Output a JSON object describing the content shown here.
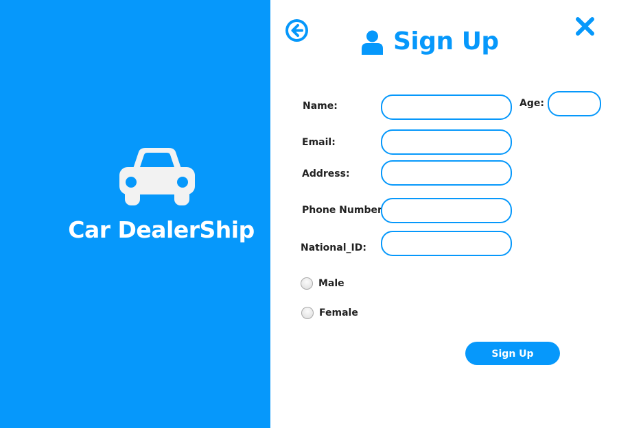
{
  "brand": {
    "title": "Car DealerShip",
    "icon": "car-icon"
  },
  "header": {
    "title": "Sign Up",
    "back_icon": "arrow-left-circle-icon",
    "close_icon": "close-x-icon",
    "user_icon": "user-icon"
  },
  "form": {
    "name": {
      "label": "Name:",
      "value": ""
    },
    "age": {
      "label": "Age:",
      "value": ""
    },
    "email": {
      "label": "Email:",
      "value": ""
    },
    "address": {
      "label": "Address:",
      "value": ""
    },
    "phone": {
      "label": "Phone Number:",
      "value": ""
    },
    "national_id": {
      "label": "National_ID:",
      "value": ""
    },
    "gender_options": [
      {
        "label": "Male",
        "selected": false
      },
      {
        "label": "Female",
        "selected": false
      }
    ],
    "submit_label": "Sign Up"
  },
  "colors": {
    "accent": "#0698fb",
    "panel_text": "#ffffff",
    "label_text": "#222222"
  }
}
